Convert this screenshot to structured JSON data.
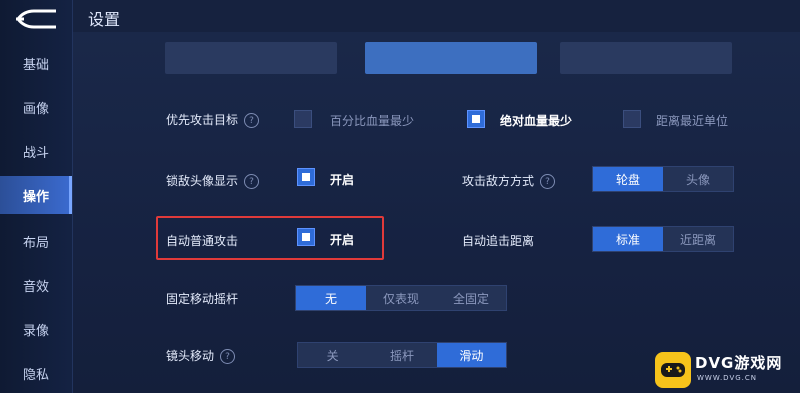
{
  "header": {
    "title": "设置"
  },
  "sidebar": {
    "items": [
      {
        "label": "基础"
      },
      {
        "label": "画像"
      },
      {
        "label": "战斗"
      },
      {
        "label": "操作",
        "active": true
      },
      {
        "label": "布局"
      },
      {
        "label": "音效"
      },
      {
        "label": "录像"
      },
      {
        "label": "隐私"
      }
    ]
  },
  "settings": {
    "target_priority": {
      "label": "优先攻击目标",
      "options": [
        {
          "label": "百分比血量最少",
          "checked": false
        },
        {
          "label": "绝对血量最少",
          "checked": true
        },
        {
          "label": "距离最近单位",
          "checked": false
        }
      ]
    },
    "kill_avatar": {
      "label": "锁敌头像显示",
      "option": "开启",
      "checked": true
    },
    "attack_mode": {
      "label": "攻击敌方方式",
      "options": [
        "轮盘",
        "头像"
      ],
      "selected": "轮盘"
    },
    "auto_attack": {
      "label": "自动普通攻击",
      "option": "开启",
      "checked": true
    },
    "auto_range": {
      "label": "自动追击距离",
      "options": [
        "标准",
        "近距离"
      ],
      "selected": "标准"
    },
    "fixed_joystick": {
      "label": "固定移动摇杆",
      "options": [
        "无",
        "仅表现",
        "全固定"
      ],
      "selected": "无"
    },
    "camera_move": {
      "label": "镜头移动",
      "options": [
        "关",
        "摇杆",
        "滑动"
      ],
      "selected": "滑动"
    }
  },
  "watermark": {
    "title": "DVG游戏网",
    "url": "WWW.DVG.CN"
  },
  "colors": {
    "accent": "#2f6cd8",
    "highlight": "#e03a3a",
    "watermark": "#f6c31b"
  }
}
